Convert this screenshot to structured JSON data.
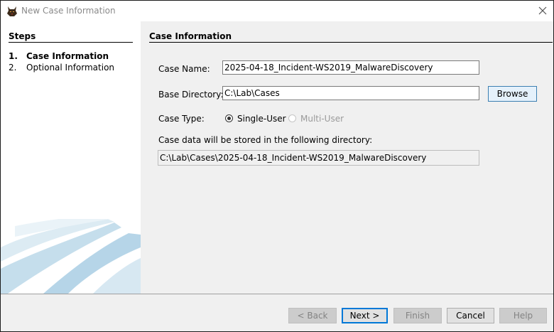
{
  "window": {
    "title": "New Case Information"
  },
  "steps": {
    "heading": "Steps",
    "items": [
      {
        "num": "1.",
        "label": "Case Information"
      },
      {
        "num": "2.",
        "label": "Optional Information"
      }
    ]
  },
  "form": {
    "heading": "Case Information",
    "case_name_label": "Case Name:",
    "case_name_value": "2025-04-18_Incident-WS2019_MalwareDiscovery",
    "base_dir_label": "Base Directory:",
    "base_dir_value": "C:\\Lab\\Cases",
    "browse_label": "Browse",
    "case_type_label": "Case Type:",
    "case_type_options": [
      "Single-User",
      "Multi-User"
    ],
    "case_type_selected": "Single-User",
    "storage_label": "Case data will be stored in the following directory:",
    "storage_path": "C:\\Lab\\Cases\\2025-04-18_Incident-WS2019_MalwareDiscovery"
  },
  "footer": {
    "back": "< Back",
    "next": "Next >",
    "finish": "Finish",
    "cancel": "Cancel",
    "help": "Help"
  },
  "icons": {
    "app": "autopsy-dog-icon",
    "close": "close-icon"
  },
  "colors": {
    "accent": "#0078d7",
    "panel": "#f0f0f0"
  }
}
